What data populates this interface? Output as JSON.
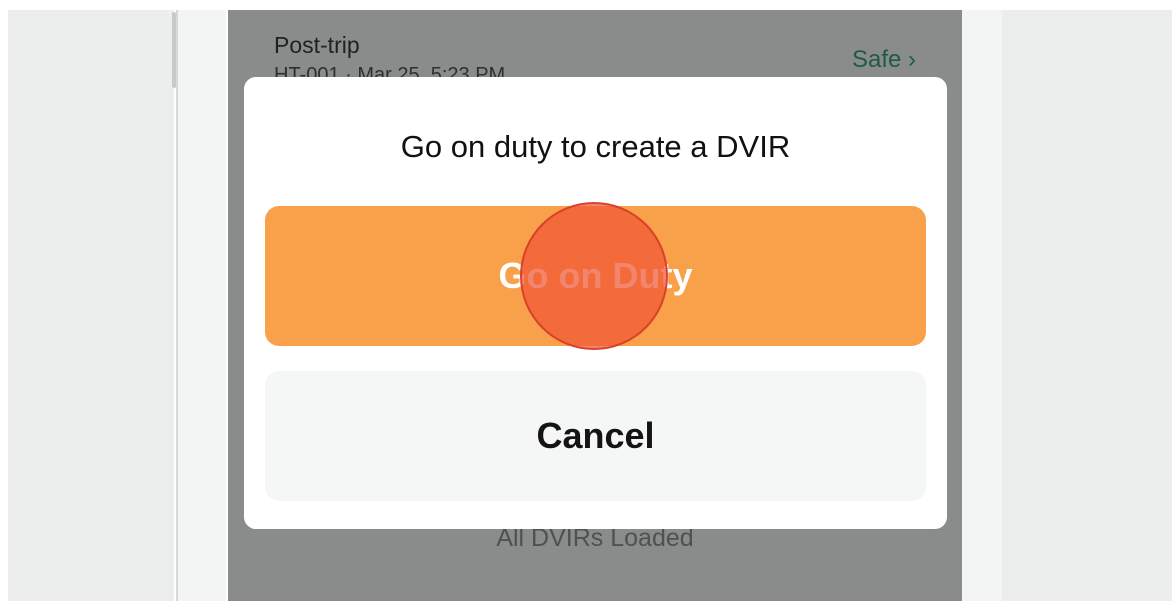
{
  "list": {
    "row": {
      "title": "Post-trip",
      "subtitle": "HT-001 · Mar 25, 5:23 PM",
      "status": "Safe ›"
    },
    "footer": "All DVIRs Loaded"
  },
  "dialog": {
    "title": "Go on duty to create a DVIR",
    "primary_label": "Go on Duty",
    "cancel_label": "Cancel"
  },
  "colors": {
    "accent": "#f9a14a",
    "touch": "#f05634",
    "status_green": "#1f5a48"
  }
}
